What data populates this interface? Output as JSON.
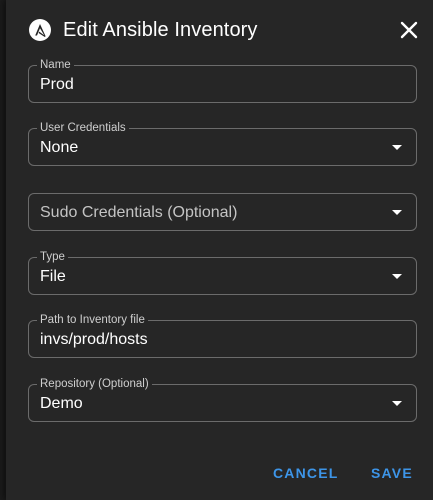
{
  "dialog": {
    "title": "Edit Ansible Inventory",
    "logo_icon": "ansible-logo-icon",
    "close_icon": "close-icon"
  },
  "fields": {
    "name": {
      "label": "Name",
      "value": "Prod"
    },
    "user_credentials": {
      "label": "User Credentials",
      "value": "None"
    },
    "sudo_credentials": {
      "placeholder": "Sudo Credentials (Optional)"
    },
    "type": {
      "label": "Type",
      "value": "File"
    },
    "inventory_path": {
      "label": "Path to Inventory file",
      "value": "invs/prod/hosts"
    },
    "repository": {
      "label": "Repository (Optional)",
      "value": "Demo"
    }
  },
  "actions": {
    "cancel_label": "CANCEL",
    "save_label": "SAVE"
  },
  "colors": {
    "background": "#262626",
    "accent": "#3d95e8",
    "border": "#6b6b6b",
    "text": "#ffffff"
  }
}
